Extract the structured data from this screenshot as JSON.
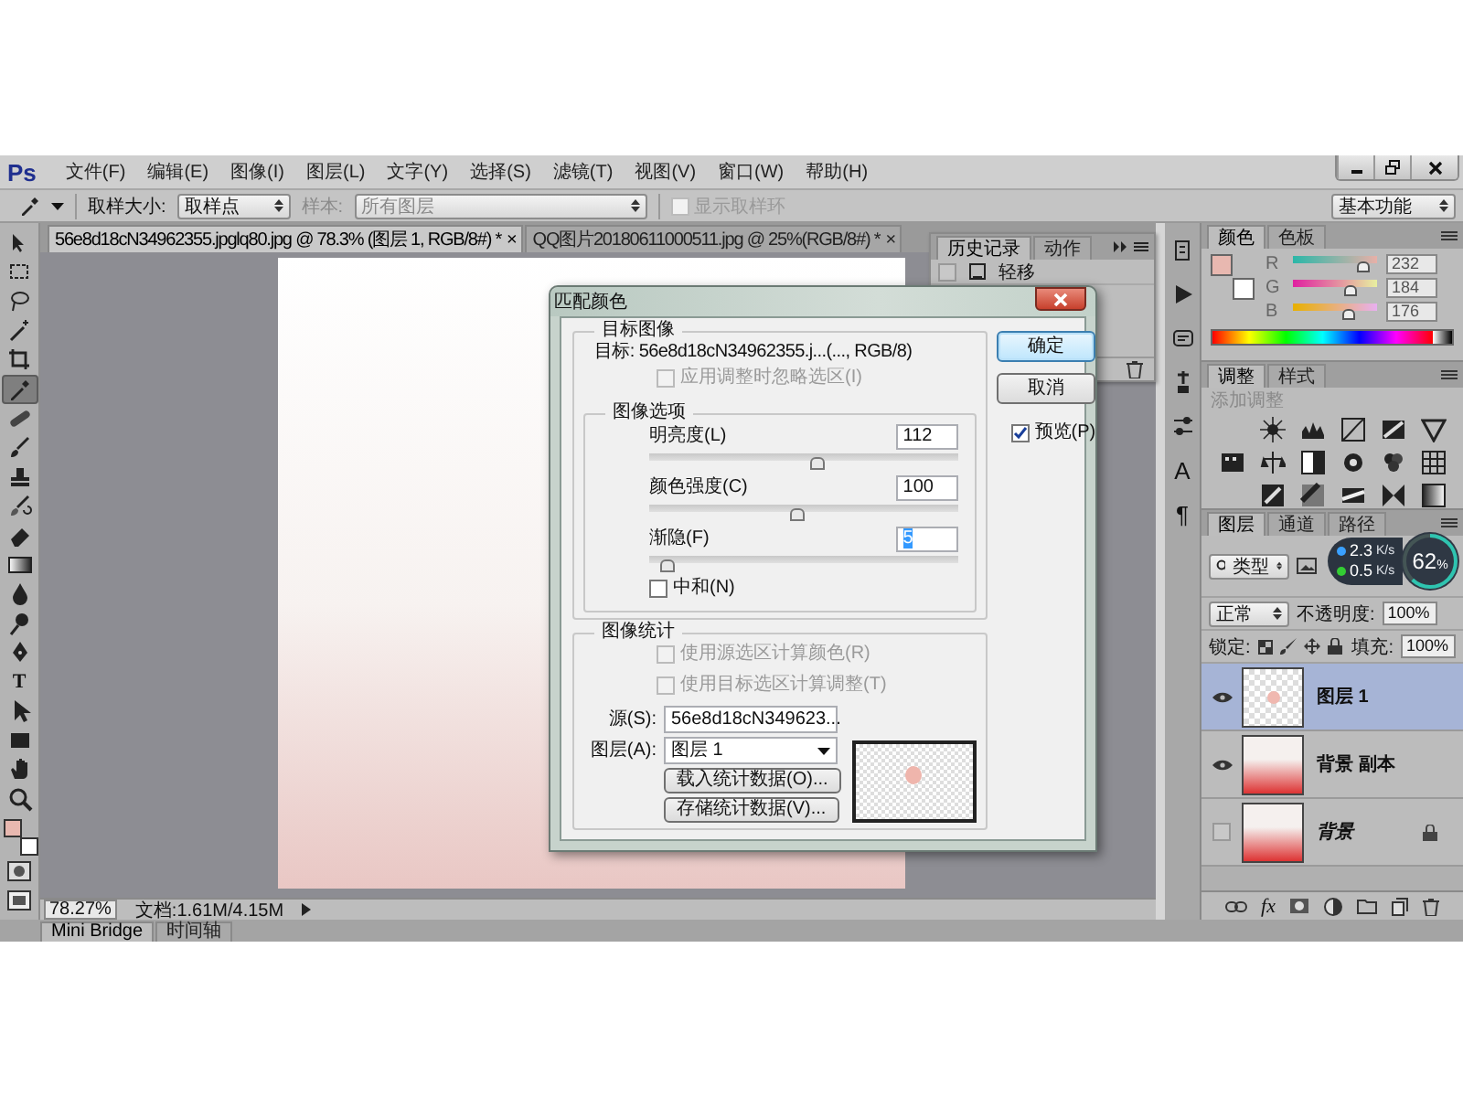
{
  "app": {
    "logo": "Ps"
  },
  "menu": [
    "文件(F)",
    "编辑(E)",
    "图像(I)",
    "图层(L)",
    "文字(Y)",
    "选择(S)",
    "滤镜(T)",
    "视图(V)",
    "窗口(W)",
    "帮助(H)"
  ],
  "options_bar": {
    "sample_size_label": "取样大小:",
    "sample_size": "取样点",
    "sample_label": "样本:",
    "sample": "所有图层",
    "sample_disabled": true,
    "show_ring": {
      "label": "显示取样环",
      "checked": false,
      "disabled": true
    },
    "workspace": "基本功能"
  },
  "tools": [
    {
      "kind": "move",
      "selected": false
    },
    {
      "kind": "marquee",
      "selected": false
    },
    {
      "kind": "lasso",
      "selected": false
    },
    {
      "kind": "wand",
      "selected": false
    },
    {
      "kind": "crop",
      "selected": false
    },
    {
      "kind": "eyedropper",
      "selected": true
    },
    {
      "kind": "bandage",
      "selected": false
    },
    {
      "kind": "brush",
      "selected": false
    },
    {
      "kind": "stamp",
      "selected": false
    },
    {
      "kind": "history_brush",
      "selected": false
    },
    {
      "kind": "eraser",
      "selected": false
    },
    {
      "kind": "gradient",
      "selected": false
    },
    {
      "kind": "blur",
      "selected": false
    },
    {
      "kind": "dodge",
      "selected": false
    },
    {
      "kind": "pen",
      "selected": false
    },
    {
      "kind": "text",
      "label": "T",
      "selected": false
    },
    {
      "kind": "path_select",
      "selected": false
    },
    {
      "kind": "shape",
      "selected": false
    },
    {
      "kind": "hand",
      "selected": false
    },
    {
      "kind": "zoom",
      "selected": false
    }
  ],
  "document": {
    "tabs": [
      {
        "title": "56e8d18cN34962355.jpglq80.jpg @ 78.3% (图层 1, RGB/8#) *",
        "close": "×",
        "selected": true
      },
      {
        "title": "QQ图片20180611000511.jpg @ 25%(RGB/8#) *",
        "close": "×",
        "selected": false
      }
    ],
    "zoom": "78.27%",
    "doc_info": "文档:1.61M/4.15M"
  },
  "bottom_tabs": [
    {
      "label": "Mini Bridge",
      "selected": true
    },
    {
      "label": "时间轴",
      "selected": false
    }
  ],
  "history_panel": {
    "tabs": [
      {
        "label": "历史记录",
        "selected": true
      },
      {
        "label": "动作",
        "selected": false
      }
    ],
    "items": [
      {
        "label": "轻移"
      }
    ]
  },
  "dock": [
    {
      "kind": "history"
    },
    {
      "kind": "actions"
    },
    {
      "kind": "presets"
    },
    {
      "kind": "brush"
    },
    {
      "kind": "clone"
    },
    {
      "kind": "character",
      "label": "A"
    },
    {
      "kind": "paragraph",
      "label": "¶"
    }
  ],
  "color_panel": {
    "tabs": [
      {
        "label": "颜色",
        "selected": true
      },
      {
        "label": "色板",
        "selected": false
      }
    ],
    "channels": [
      {
        "name": "R",
        "value": "232",
        "level": 0.91
      },
      {
        "name": "G",
        "value": "184",
        "level": 0.72
      },
      {
        "name": "B",
        "value": "176",
        "level": 0.69
      }
    ]
  },
  "adjustments_panel": {
    "tabs": [
      {
        "label": "调整",
        "selected": true
      },
      {
        "label": "样式",
        "selected": false
      }
    ],
    "hint": "添加调整"
  },
  "layers_panel": {
    "tabs": [
      {
        "label": "图层",
        "selected": true
      },
      {
        "label": "通道",
        "selected": false
      },
      {
        "label": "路径",
        "selected": false
      }
    ],
    "filter": "类型",
    "blend_mode": "正常",
    "opacity_label": "不透明度:",
    "opacity": "100%",
    "lock_label": "锁定:",
    "fill_label": "填充:",
    "fill": "100%",
    "fx_label": "fx",
    "layers": [
      {
        "name": "图层 1",
        "kind": "transparent",
        "visible": true,
        "selected": true,
        "locked": false
      },
      {
        "name": "背景 副本",
        "kind": "photo",
        "visible": true,
        "selected": false,
        "locked": false
      },
      {
        "name": "背景",
        "kind": "background",
        "visible": false,
        "selected": false,
        "locked": true
      }
    ]
  },
  "speed_widget": {
    "upload": "2.3",
    "upload_unit": "K/s",
    "download": "0.5",
    "download_unit": "K/s",
    "percent": "62",
    "percent_sign": "%",
    "level": 0.62
  },
  "dialog": {
    "title": "匹配颜色",
    "target_group": {
      "title": "目标图像",
      "target_label": "目标:",
      "target": "56e8d18cN34962355.j...(..., RGB/8)",
      "ignore_selection": {
        "label": "应用调整时忽略选区(I)",
        "checked": false,
        "disabled": true
      }
    },
    "options_group": {
      "title": "图像选项",
      "sliders": [
        {
          "label": "明亮度(L)",
          "value": "112",
          "level": 0.55,
          "value_selected": false
        },
        {
          "label": "颜色强度(C)",
          "value": "100",
          "level": 0.48,
          "value_selected": false
        },
        {
          "label": "渐隐(F)",
          "value": "5",
          "level": 0.04,
          "value_selected": true
        }
      ],
      "neutralize": {
        "label": "中和(N)",
        "checked": false,
        "disabled": false
      }
    },
    "stats_group": {
      "title": "图像统计",
      "checkboxes": [
        {
          "label": "使用源选区计算颜色(R)",
          "checked": false,
          "disabled": true
        },
        {
          "label": "使用目标选区计算调整(T)",
          "checked": false,
          "disabled": true
        }
      ],
      "source_label": "源(S):",
      "source": "56e8d18cN349623...",
      "layer_label": "图层(A):",
      "layer": "图层 1",
      "buttons": [
        "载入统计数据(O)...",
        "存储统计数据(V)..."
      ]
    },
    "buttons": [
      {
        "label": "确定",
        "default": true
      },
      {
        "label": "取消",
        "default": false
      }
    ],
    "preview": {
      "label": "预览(P)",
      "checked": true
    }
  }
}
